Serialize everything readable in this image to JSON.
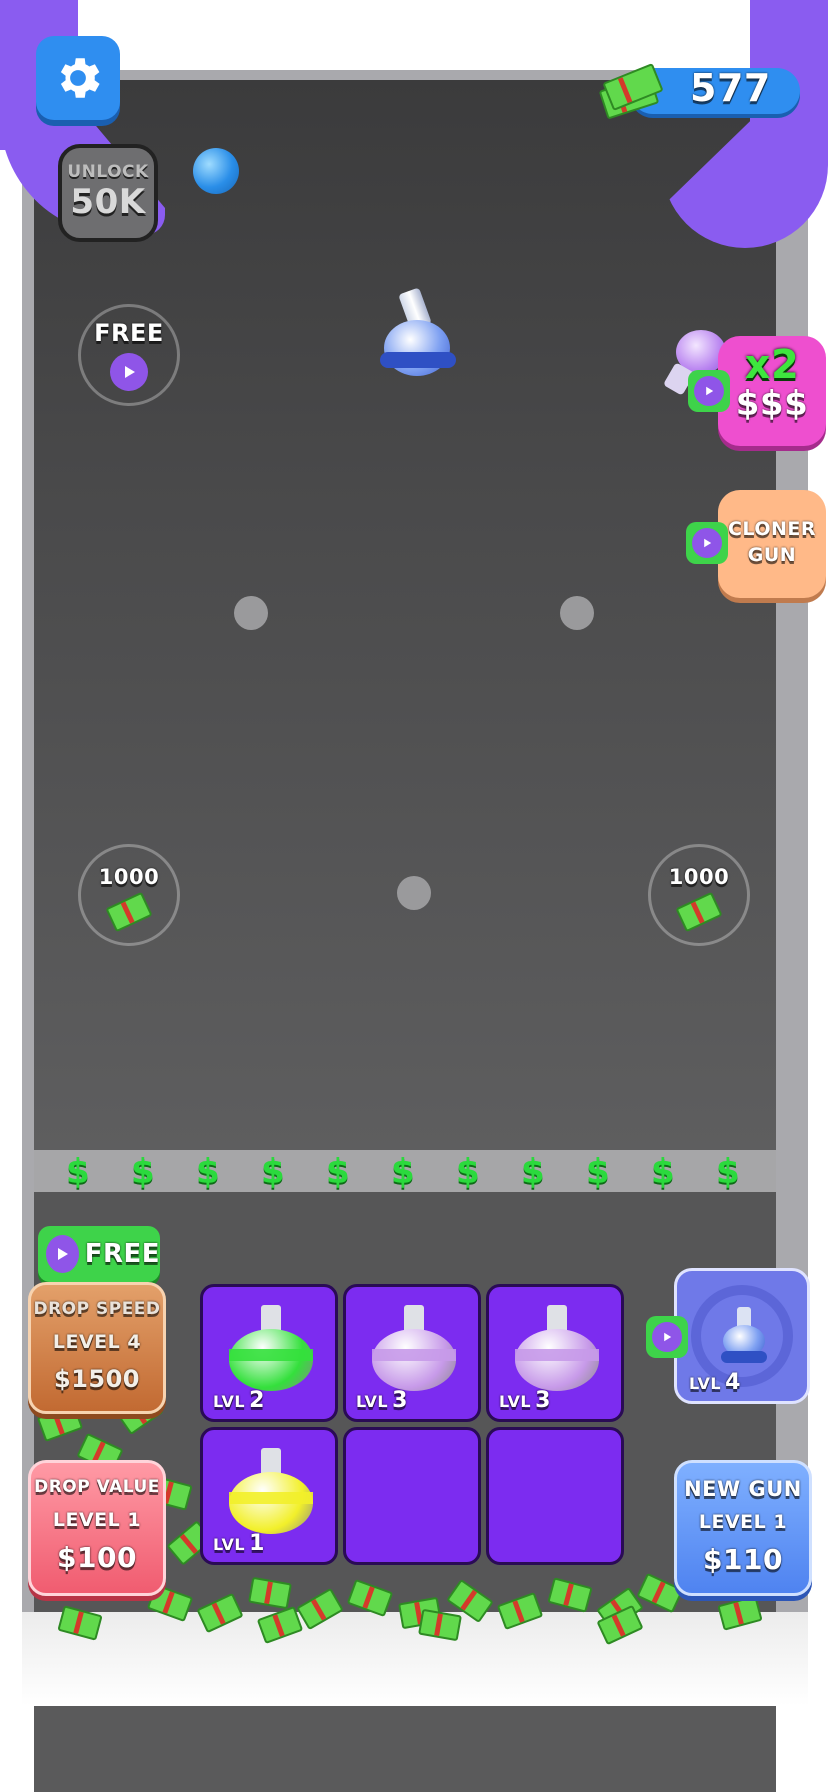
{
  "currency": {
    "amount": "577",
    "icon": "cash-stack-icon"
  },
  "unlock": {
    "line1": "UNLOCK",
    "line2": "50K"
  },
  "free_bonus": {
    "label": "FREE"
  },
  "multiplier": {
    "line1": "x2",
    "line2": "$$$"
  },
  "cloner_gun": {
    "line1": "CLONER",
    "line2": "GUN"
  },
  "cash_pickups": [
    {
      "value": "1000"
    },
    {
      "value": "1000"
    }
  ],
  "conveyor_symbol": "$",
  "drop_speed": {
    "free_label": "FREE",
    "title": "DROP SPEED",
    "level": "LEVEL 4",
    "price": "$1500"
  },
  "drop_value": {
    "title": "DROP VALUE",
    "level": "LEVEL 1",
    "price": "$100"
  },
  "new_gun": {
    "title": "NEW GUN",
    "level": "LEVEL 1",
    "price": "$110"
  },
  "gun_slot": {
    "lvl_prefix": "LVL",
    "level": "4"
  },
  "grid": [
    {
      "lvl_prefix": "LVL",
      "level": "2",
      "color": "#34e03c"
    },
    {
      "lvl_prefix": "LVL",
      "level": "3",
      "color": "#c79ae9"
    },
    {
      "lvl_prefix": "LVL",
      "level": "3",
      "color": "#c79ae9"
    },
    {
      "lvl_prefix": "LVL",
      "level": "1",
      "color": "#f2f02a"
    },
    {
      "lvl_prefix": "",
      "level": "",
      "color": ""
    },
    {
      "lvl_prefix": "",
      "level": "",
      "color": ""
    }
  ],
  "colors": {
    "accent_purple": "#8a5cf0",
    "settings_blue": "#2f8ef0",
    "cash_green": "#2bd93d",
    "cell_purple": "#7c2cf0"
  }
}
